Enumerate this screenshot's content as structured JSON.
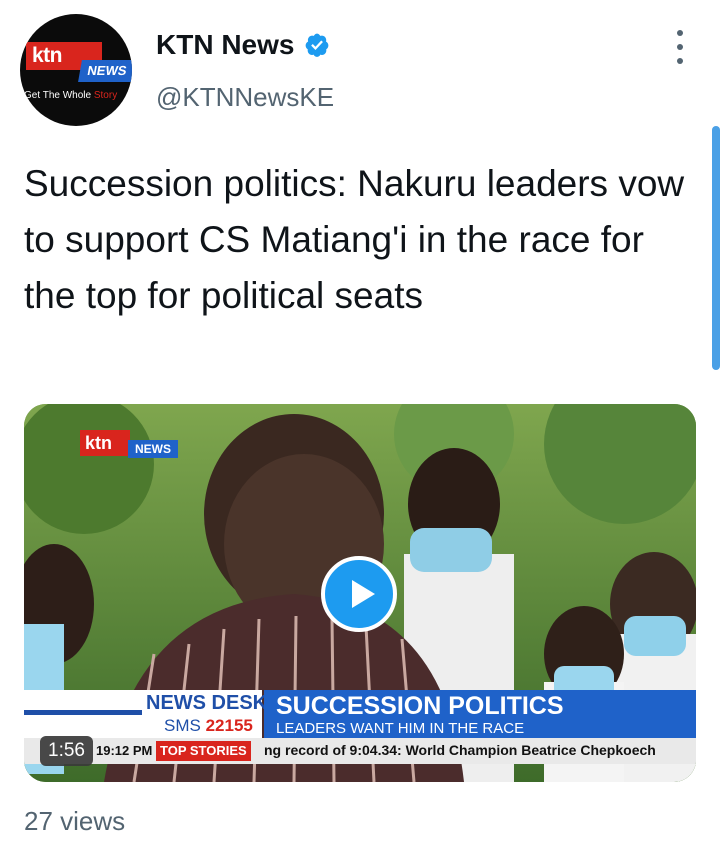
{
  "account": {
    "name": "KTN News",
    "handle": "@KTNNewsKE",
    "verified": true,
    "avatar": {
      "logo_ktn": "ktn",
      "logo_news": "NEWS",
      "tagline_start": "Get The Whole ",
      "tagline_end": "Story"
    }
  },
  "tweet": {
    "text": "Succession politics: Nakuru leaders vow to support CS Matiang'i in the race for the top for political seats"
  },
  "media": {
    "logo_ktn": "ktn",
    "logo_news": "NEWS",
    "desk_title": "NEWS DESK",
    "desk_sms_label": "SMS",
    "desk_sms_number": "22155",
    "headline": "SUCCESSION POLITICS",
    "subheadline": "LEADERS WANT HIM IN THE RACE",
    "ticker_time": "19:12 PM",
    "ticker_label": "TOP STORIES",
    "ticker_text": "ng record of 9:04.34: World Champion Beatrice Chepkoech",
    "duration": "1:56",
    "play_icon": "play-icon"
  },
  "stats": {
    "views": "27 views"
  },
  "colors": {
    "brand_red": "#d9251d",
    "brand_blue": "#1f62c9",
    "twitter_blue": "#1d9bf0",
    "secondary_text": "#536471"
  }
}
